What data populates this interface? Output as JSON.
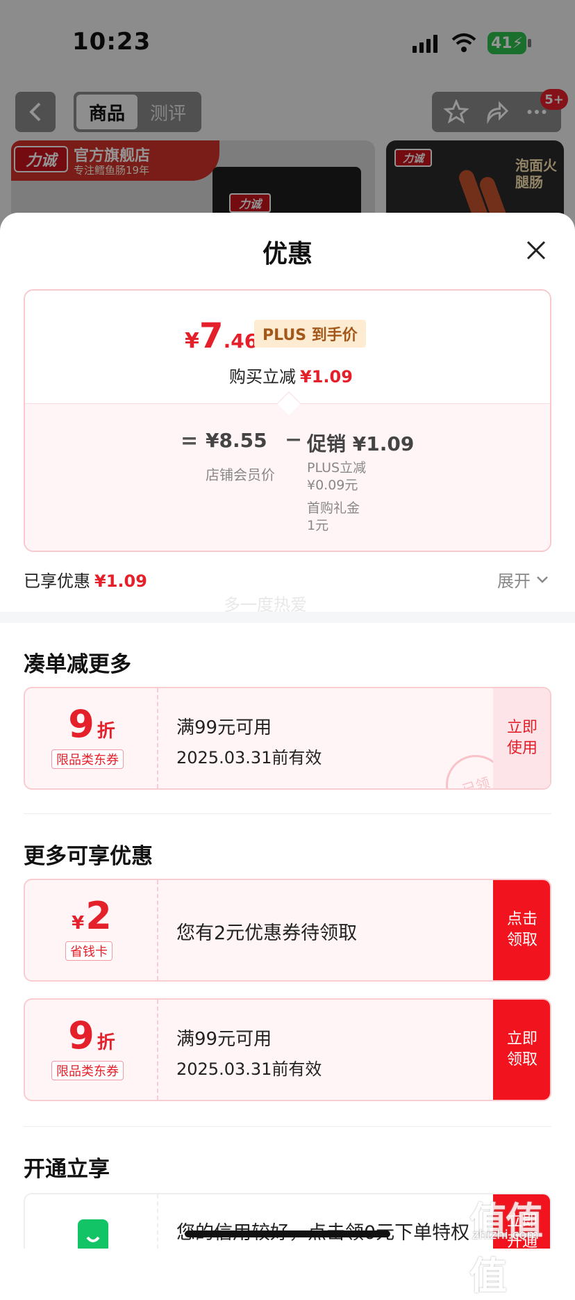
{
  "status_bar": {
    "time": "10:23",
    "battery": "41"
  },
  "nav": {
    "tabs": [
      "商品",
      "测评"
    ],
    "badge": "5+"
  },
  "banner": {
    "brand_logo": "力诚",
    "store_name": "官方旗舰店",
    "slogan": "专注鳕鱼肠19年",
    "side_text": "泡面火腿肠"
  },
  "sheet": {
    "title": "优惠",
    "price_summary": {
      "currency": "¥",
      "price_int": "7",
      "price_dec": ".46",
      "plus_tag": "PLUS 到手价",
      "reduce_label": "购买立减",
      "reduce_value": "¥1.09",
      "eq": "=",
      "member_price": "¥8.55",
      "member_label": "店铺会员价",
      "minus": "−",
      "promo": "促销 ¥1.09",
      "promo_items": [
        "PLUS立减",
        "¥0.09元",
        "首购礼金",
        "1元"
      ]
    },
    "enjoyed_label": "已享优惠",
    "enjoyed_value": "¥1.09",
    "expand_label": "展开",
    "watermark": "多一度热爱",
    "section_more": "凑单减更多",
    "section_available": "更多可享优惠",
    "section_open": "开通立享",
    "coupons": [
      {
        "value": "9",
        "unit": "折",
        "tag": "限品类东券",
        "line1": "满99元可用",
        "line2": "2025.03.31前有效",
        "button": "立即使用",
        "stamp": "已领"
      },
      {
        "value": "2",
        "unit": "¥",
        "tag": "省钱卡",
        "line1": "您有2元优惠券待领取",
        "button": "点击领取"
      },
      {
        "value": "9",
        "unit": "折",
        "tag": "限品类东券",
        "line1": "满99元可用",
        "line2": "2025.03.31前有效",
        "button": "立即领取"
      }
    ],
    "credit": {
      "text": "您的信用较好，点击领0元下单特权",
      "button": "立即开通"
    }
  },
  "site_watermark": {
    "mark": "值值值",
    "url": "zhizhi.com"
  },
  "colors": {
    "accent_red": "#e4202a",
    "button_red": "#f1141e",
    "plus_bg": "#fdecd2",
    "credit_green": "#12c466"
  }
}
